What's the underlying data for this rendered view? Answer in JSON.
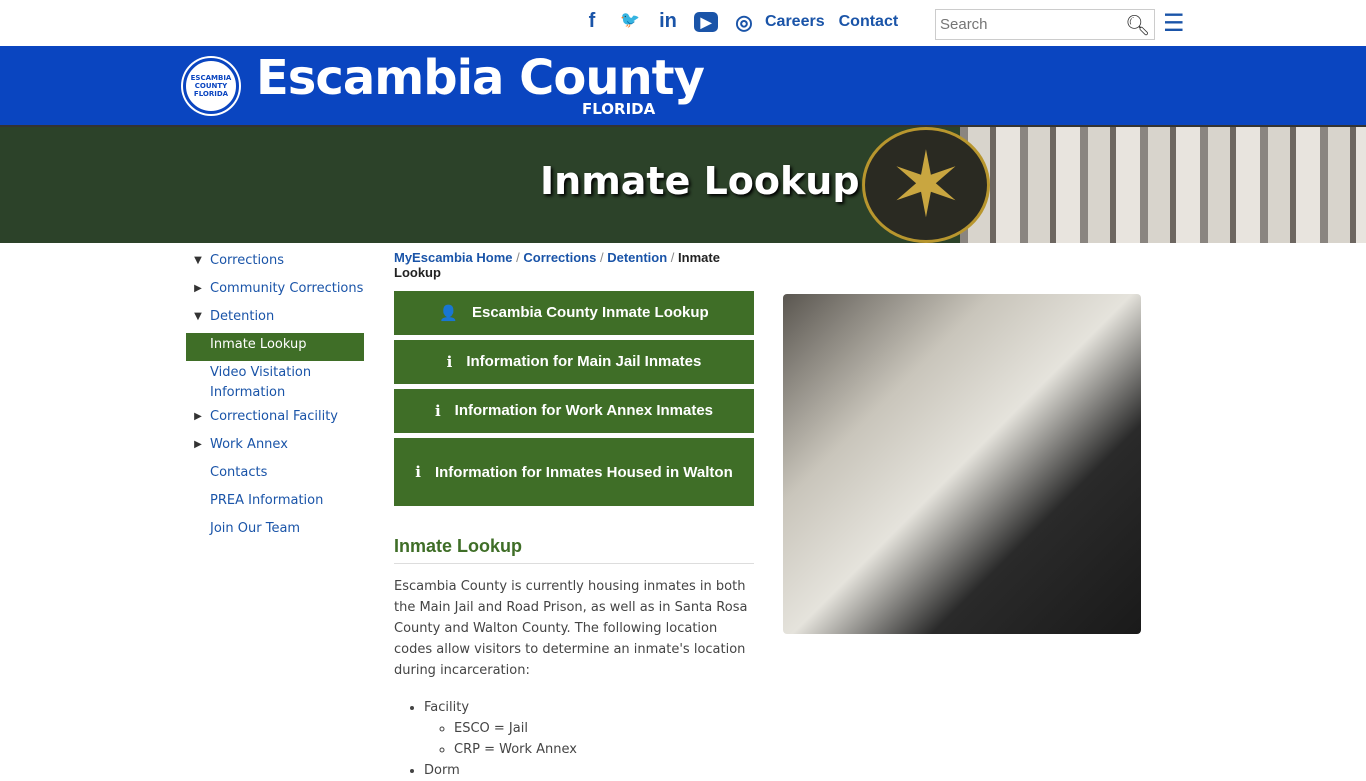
{
  "topbar": {
    "social": [
      {
        "icon": "facebook-icon",
        "glyph": "f"
      },
      {
        "icon": "twitter-icon",
        "glyph": "🐦"
      },
      {
        "icon": "linkedin-icon",
        "glyph": "in"
      },
      {
        "icon": "youtube-icon",
        "glyph": "▶"
      },
      {
        "icon": "instagram-icon",
        "glyph": "◎"
      }
    ],
    "links": [
      "Careers",
      "Contact"
    ],
    "search_placeholder": "Search"
  },
  "brand": {
    "title": "Escambia County",
    "subtitle": "FLORIDA",
    "seal_text": "ESCAMBIA COUNTY FLORIDA"
  },
  "hero": {
    "title": "Inmate Lookup"
  },
  "sidebar": {
    "items": [
      {
        "label": "Corrections",
        "arrow": "▼"
      },
      {
        "label": "Community Corrections",
        "arrow": "▶"
      },
      {
        "label": "Detention",
        "arrow": "▼"
      },
      {
        "label": "Inmate Lookup",
        "arrow": "",
        "active": true
      },
      {
        "label": "Video Visitation Information",
        "arrow": ""
      },
      {
        "label": "Correctional Facility",
        "arrow": "▶"
      },
      {
        "label": "Work Annex",
        "arrow": "▶"
      },
      {
        "label": "Contacts",
        "arrow": ""
      },
      {
        "label": "PREA Information",
        "arrow": ""
      },
      {
        "label": "Join Our Team",
        "arrow": ""
      }
    ]
  },
  "breadcrumb": [
    "MyEscambia Home",
    "Corrections",
    "Detention",
    "Inmate Lookup"
  ],
  "buttons": [
    {
      "label": "Escambia County Inmate Lookup",
      "icon": "👤"
    },
    {
      "label": "Information for Main Jail Inmates",
      "icon": "i"
    },
    {
      "label": "Information for Work Annex Inmates",
      "icon": "i"
    },
    {
      "label": "Information for Inmates Housed in Walton",
      "icon": "i"
    }
  ],
  "section": {
    "heading": "Inmate Lookup",
    "paragraph": "Escambia County is currently housing inmates in both the Main Jail and Road Prison, as well as in Santa Rosa County and Walton County. The following location codes allow visitors to determine an inmate's location during incarceration:",
    "list": {
      "facility": "Facility",
      "codes": [
        "ESCO = Jail",
        "CRP = Work Annex"
      ],
      "dorm": "Dorm"
    }
  },
  "colors": {
    "blue": "#0a45c0",
    "green": "#3f6e27",
    "link": "#1a54a8"
  }
}
